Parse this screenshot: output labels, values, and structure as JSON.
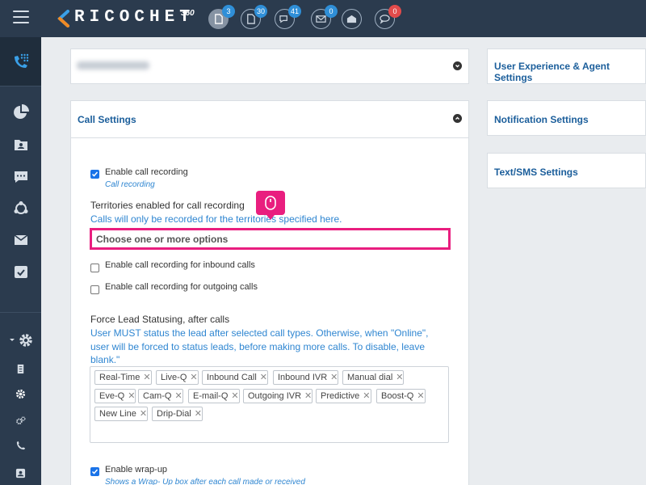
{
  "app": {
    "logo_text": "RICOCHET",
    "logo_sup": "360",
    "menu_icon": "hamburger-icon"
  },
  "topbar": {
    "badges": [
      {
        "icon": "document-icon",
        "count": "3"
      },
      {
        "icon": "document-icon",
        "count": "30"
      },
      {
        "icon": "chat-icon",
        "count": "41"
      },
      {
        "icon": "mail-icon",
        "count": "0"
      },
      {
        "icon": "mail-open-icon",
        "count": ""
      },
      {
        "icon": "speech-bubble-icon",
        "count": "0"
      }
    ],
    "colors": {
      "bar": "#2b3b4e",
      "badge_blue": "#2f8fd8",
      "badge_red": "#e24b4b"
    }
  },
  "sidebar": {
    "items": [
      "phone-dialpad-icon",
      "pie-chart-icon",
      "contacts-icon",
      "chat-icon",
      "network-icon",
      "mail-icon",
      "checklist-icon",
      "settings-icon",
      "document-icon",
      "gear-icon",
      "gears-icon",
      "phone-icon",
      "contact-card-icon"
    ]
  },
  "panels": {
    "blurred_panel": {
      "toggle": "chevron-down-icon"
    },
    "call_settings": {
      "title": "Call Settings",
      "toggle": "chevron-up-icon",
      "enable_recording": {
        "label": "Enable call recording",
        "sub": "Call recording",
        "checked": true
      },
      "territories": {
        "heading": "Territories enabled for call recording",
        "help": "Calls will only be recorded for the territories specified here.",
        "placeholder": "Choose one or more options"
      },
      "inbound": {
        "label": "Enable call recording for inbound calls",
        "checked": false
      },
      "outgoing": {
        "label": "Enable call recording for outgoing calls",
        "checked": false
      },
      "force_lead": {
        "heading": "Force Lead Statusing, after calls",
        "help": "User MUST status the lead after selected call types. Otherwise, when \"Online\", user will be forced to status leads, before making more calls. To disable, leave blank.\"",
        "tags": [
          "Real-Time",
          "Live-Q",
          "Inbound Call",
          "Inbound IVR",
          "Manual dial",
          "Eve-Q",
          "Cam-Q",
          "E-mail-Q",
          "Outgoing IVR",
          "Predictive",
          "Boost-Q",
          "New Line",
          "Drip-Dial"
        ]
      },
      "wrap_up": {
        "label": "Enable wrap-up",
        "sub": "Shows a Wrap- Up box after each call made or received",
        "checked": true
      }
    },
    "user_experience": {
      "title": "User Experience & Agent Settings"
    },
    "notification": {
      "title": "Notification Settings"
    },
    "text_sms": {
      "title": "Text/SMS Settings"
    }
  },
  "highlight_color": "#e91e7f"
}
